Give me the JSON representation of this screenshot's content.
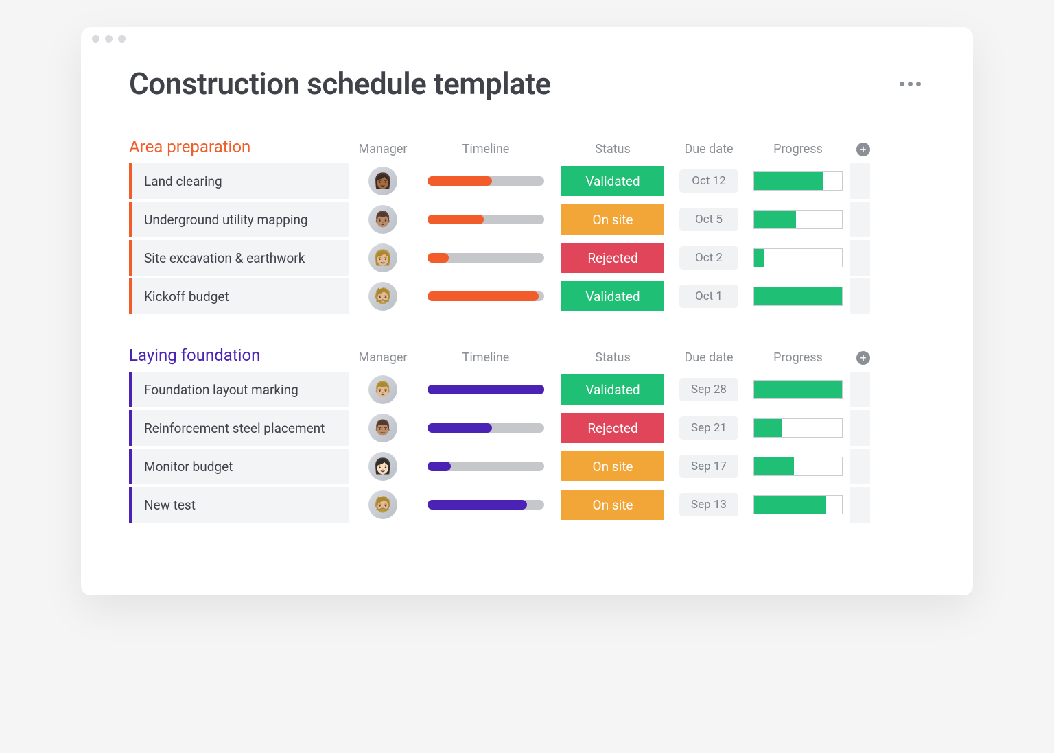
{
  "page": {
    "title": "Construction schedule template"
  },
  "columns": {
    "manager": "Manager",
    "timeline": "Timeline",
    "status": "Status",
    "due": "Due date",
    "progress": "Progress"
  },
  "status_colors": {
    "Validated": "#1fbf75",
    "On site": "#f2a638",
    "Rejected": "#e0455a"
  },
  "groups": [
    {
      "name": "Area preparation",
      "accent": "#f25c2a",
      "items": [
        {
          "task": "Land clearing",
          "avatar": "👩🏾",
          "timeline_pct": 55,
          "status": "Validated",
          "due": "Oct 12",
          "progress_pct": 78
        },
        {
          "task": "Underground utility mapping",
          "avatar": "👨🏽",
          "timeline_pct": 48,
          "status": "On site",
          "due": "Oct 5",
          "progress_pct": 48
        },
        {
          "task": "Site excavation & earthwork",
          "avatar": "👩🏼",
          "timeline_pct": 18,
          "status": "Rejected",
          "due": "Oct 2",
          "progress_pct": 12
        },
        {
          "task": "Kickoff budget",
          "avatar": "🧔🏼",
          "timeline_pct": 95,
          "status": "Validated",
          "due": "Oct 1",
          "progress_pct": 100
        }
      ]
    },
    {
      "name": "Laying foundation",
      "accent": "#4a22b6",
      "items": [
        {
          "task": "Foundation layout marking",
          "avatar": "👨🏼",
          "timeline_pct": 100,
          "status": "Validated",
          "due": "Sep 28",
          "progress_pct": 100
        },
        {
          "task": "Reinforcement steel placement",
          "avatar": "👨🏽",
          "timeline_pct": 55,
          "status": "Rejected",
          "due": "Sep 21",
          "progress_pct": 32
        },
        {
          "task": "Monitor budget",
          "avatar": "👩🏻",
          "timeline_pct": 20,
          "status": "On site",
          "due": "Sep 17",
          "progress_pct": 45
        },
        {
          "task": "New test",
          "avatar": "🧔🏼",
          "timeline_pct": 85,
          "status": "On site",
          "due": "Sep 13",
          "progress_pct": 82
        }
      ]
    }
  ]
}
